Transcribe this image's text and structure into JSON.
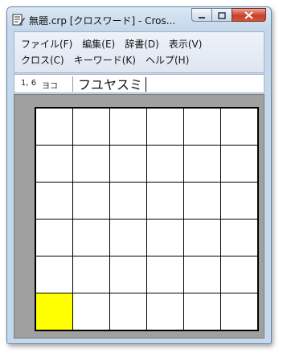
{
  "window": {
    "title": "無題.crp [クロスワード] - Cros..."
  },
  "menu": {
    "row1": [
      "ファイル(F)",
      "編集(E)",
      "辞書(D)",
      "表示(V)"
    ],
    "row2": [
      "クロス(C)",
      "キーワード(K)",
      "ヘルプ(H)"
    ]
  },
  "status": {
    "position": "1, 6",
    "direction": "ヨコ",
    "keyword_value": "フユヤスミ"
  },
  "grid": {
    "rows": 6,
    "cols": 6,
    "selected_cell": [
      6,
      1
    ],
    "selected_color": "#ffff00"
  },
  "icons": {
    "app": "app-icon",
    "minimize": "minimize-icon",
    "maximize": "maximize-icon",
    "close": "close-icon"
  }
}
